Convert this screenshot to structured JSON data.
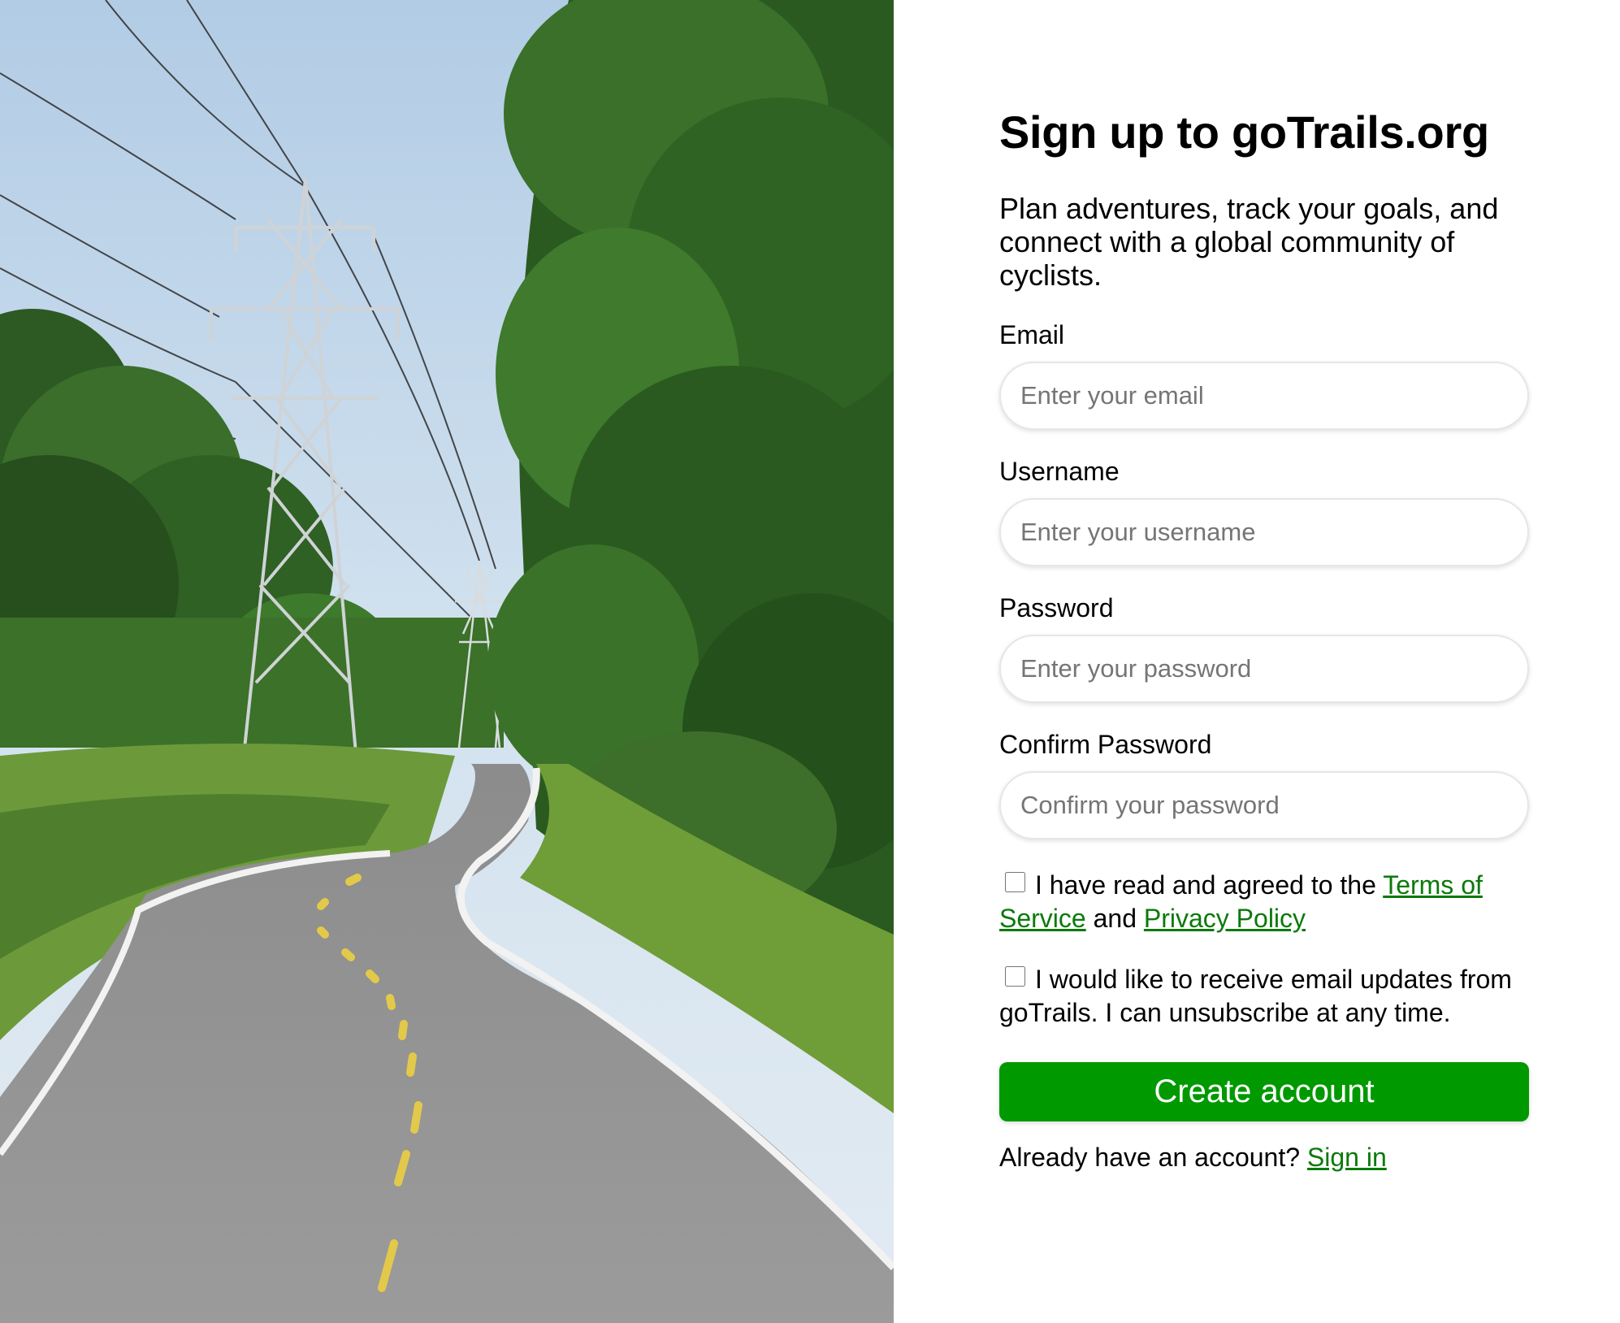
{
  "colors": {
    "accent": "#009900",
    "link": "#0a7a0a",
    "placeholder": "#757575"
  },
  "hero_image": {
    "subject": "winding bike trail under power line towers through green forest"
  },
  "signup": {
    "title": "Sign up to goTrails.org",
    "subtitle": "Plan adventures, track your goals, and connect with a global community of cyclists.",
    "email": {
      "label": "Email",
      "placeholder": "Enter your email",
      "value": ""
    },
    "username": {
      "label": "Username",
      "placeholder": "Enter your username",
      "value": ""
    },
    "password": {
      "label": "Password",
      "placeholder": "Enter your password",
      "value": ""
    },
    "confirm_password": {
      "label": "Confirm Password",
      "placeholder": "Confirm your password",
      "value": ""
    },
    "terms": {
      "checked": false,
      "text_before": "I have read and agreed to the ",
      "terms_link": "Terms of Service",
      "text_middle": " and ",
      "privacy_link": "Privacy Policy"
    },
    "updates": {
      "checked": false,
      "text": "I would like to receive email updates from goTrails. I can unsubscribe at any time."
    },
    "create_button": "Create account",
    "signin": {
      "prompt": "Already have an account? ",
      "link": "Sign in"
    }
  }
}
